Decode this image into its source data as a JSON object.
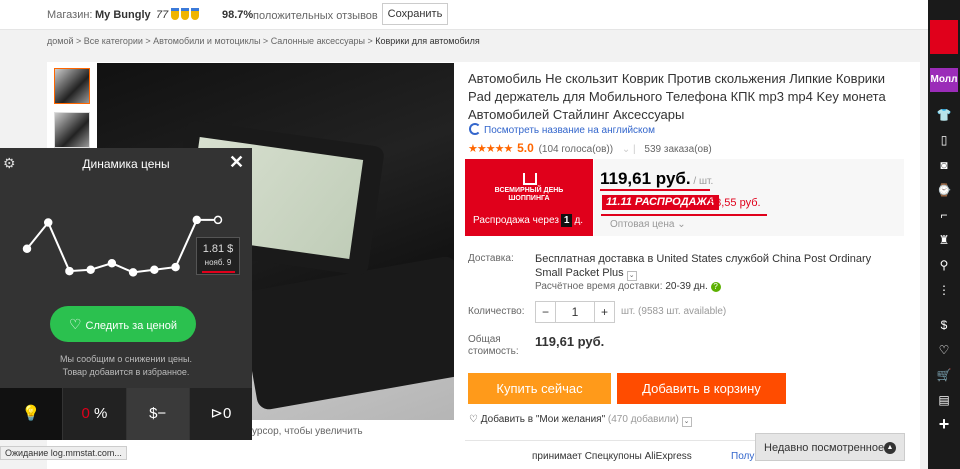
{
  "topbar": {
    "store_label": "Магазин:",
    "store_name": "My Bungly",
    "score": "77",
    "positive_pct": "98.7%",
    "feedback_label": "положительных отзывов ⌄",
    "save_label": "Сохранить"
  },
  "breadcrumbs": [
    "домой",
    "Все категории",
    "Автомобили и мотоциклы",
    "Салонные аксессуары",
    "Коврики для автомобиля"
  ],
  "product": {
    "title": "Автомобиль Не скользит Коврик Против скольжения Липкие Коврики Pad держатель для Мобильного Телефона КПК mp3 mp4 Key монета Автомобилей Стайлинг Аксессуары",
    "translate_link": "Посмотреть название на английском",
    "rating_value": "5.0",
    "votes": "(104 голоса(ов))",
    "orders": "539 заказа(ов)",
    "zoom_hint": "урсор, чтобы увеличить"
  },
  "banner": {
    "line1": "ВСЕМИРНЫЙ ДЕНЬ",
    "line2": "ШОППИНГА",
    "countdown_label": "Распродажа через",
    "countdown_value": "1",
    "countdown_unit": "д."
  },
  "price": {
    "main": "119,61 руб.",
    "unit": " / шт.",
    "sale_tag": "11.11 РАСПРОДАЖА",
    "sale_price": "88,55 руб.",
    "wholesale": "Оптовая цена ⌄"
  },
  "shipping": {
    "label": "Доставка:",
    "text": "Бесплатная доставка в United States службой China Post Ordinary Small Packet Plus",
    "eta_label": "Расчётное время доставки:",
    "eta_value": "20-39 дн."
  },
  "quantity": {
    "label": "Количество:",
    "minus": "−",
    "value": "1",
    "plus": "+",
    "unit_note": "шт. (9583 шт. available)"
  },
  "total": {
    "label1": "Общая",
    "label2": "стоимость:",
    "value": "119,61 руб."
  },
  "actions": {
    "buy_now": "Купить сейчас",
    "add_to_cart": "Добавить в корзину",
    "wishlist": "Добавить в \"Мои желания\"",
    "wishlist_count": "(470 добавили)"
  },
  "coupon": {
    "text": "принимает Спецкупоны AliExpress",
    "link": "Полу"
  },
  "recently_viewed": "Недавно посмотренное",
  "right_sidebar": {
    "moll": "Молл",
    "icons": [
      "shirt-icon",
      "phone-icon",
      "camera-icon",
      "watch-icon",
      "shoe-icon",
      "bottle-icon",
      "location-icon",
      "more-icon",
      "dollar-icon",
      "heart-icon",
      "cart-icon",
      "clipboard-icon",
      "plus-icon"
    ]
  },
  "price_panel": {
    "title": "Динамика цены",
    "tooltip_price": "1.81 $",
    "tooltip_date": "нояб. 9",
    "follow_label": "Следить за ценой",
    "note_line1": "Мы сообщим о снижении цены.",
    "note_line2": "Товар добавится в избранное.",
    "tab_percent_zero": "0",
    "tab_percent_sign": " %",
    "tab_dollar": "$−",
    "tab_play": "⊳0",
    "series": [
      1.75,
      1.95,
      1.58,
      1.59,
      1.64,
      1.57,
      1.59,
      1.61,
      1.97,
      1.97
    ]
  },
  "status_bar": "Ожидание log.mmstat.com..."
}
